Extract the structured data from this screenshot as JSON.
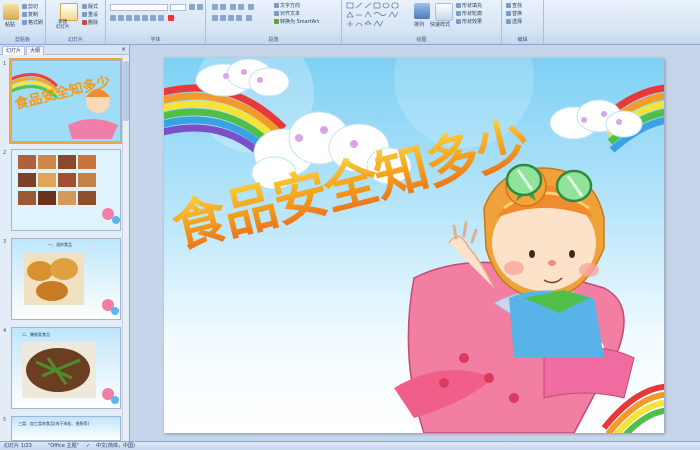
{
  "ribbon": {
    "clipboard": {
      "paste": "粘贴",
      "cut": "剪切",
      "copy": "复制",
      "format_painter": "格式刷",
      "label": "剪贴板"
    },
    "slides": {
      "new_slide": "新建\n幻灯片",
      "layout": "版式",
      "reset": "重设",
      "delete": "删除",
      "label": "幻灯片"
    },
    "font": {
      "label": "字体"
    },
    "paragraph": {
      "text_direction": "文字方向",
      "align_text": "对齐文本",
      "smartart": "转换为 SmartArt",
      "label": "段落"
    },
    "drawing": {
      "arrange": "排列",
      "quick_styles": "快速样式",
      "shape_fill": "形状填充",
      "shape_outline": "形状轮廓",
      "shape_effects": "形状效果",
      "label": "绘图"
    },
    "editing": {
      "find": "查找",
      "replace": "替换",
      "select": "选择",
      "label": "编辑"
    }
  },
  "pane": {
    "tab_slides": "幻灯片",
    "tab_outline": "大纲",
    "close": "×",
    "thumbnails": [
      {
        "number": "1",
        "caption": "",
        "selected": true
      },
      {
        "number": "2",
        "caption": "",
        "selected": false
      },
      {
        "number": "3",
        "caption": "一、油炸食品",
        "selected": false
      },
      {
        "number": "4",
        "caption": "二、腌制类食品",
        "selected": false
      },
      {
        "number": "5",
        "caption": "三类、加工类肉食品(肉干肉松、香肠等)",
        "selected": false
      }
    ]
  },
  "slide": {
    "title": "食品安全知多少"
  },
  "status": {
    "slide_position": "幻灯片 1/23",
    "theme": "\"Office 主题\"",
    "language": "中文(简体，中国)"
  },
  "colors": {
    "ribbon_bg": "#d6e4f5",
    "selection": "#f0a640",
    "title_gradient_top": "#ffe94a",
    "title_gradient_bottom": "#e8631e"
  }
}
